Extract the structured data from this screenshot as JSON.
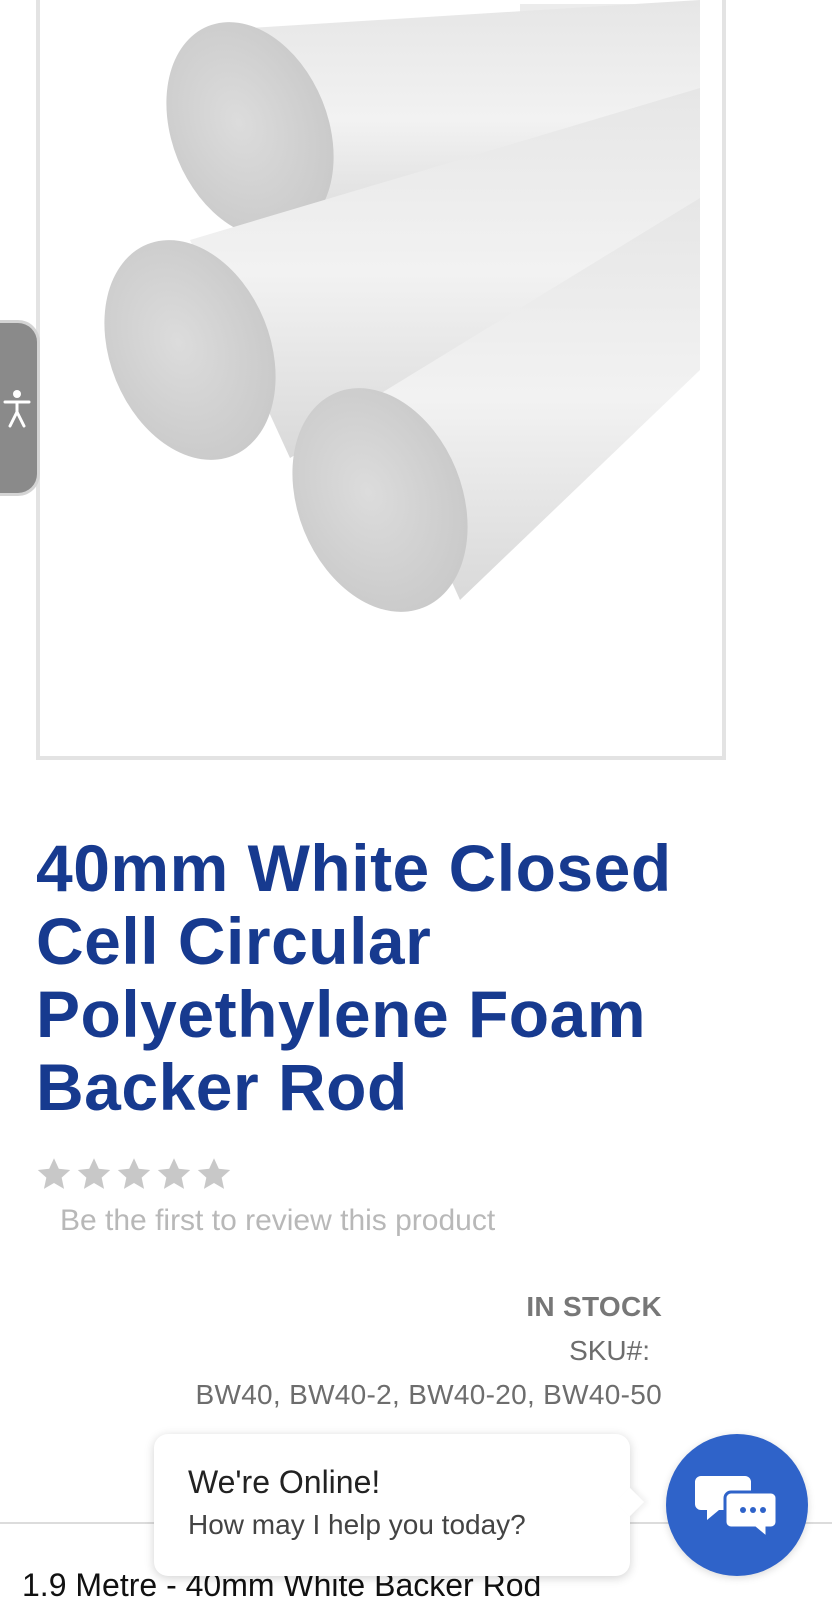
{
  "product": {
    "title": "40mm White Closed Cell Circular Polyethylene Foam Backer Rod",
    "image_alt": "White foam backer rods",
    "rating": {
      "value": 0,
      "max": 5
    },
    "review_prompt": "Be the first to review this product",
    "stock_status": "IN STOCK",
    "sku_label": "SKU#:",
    "sku_values": "BW40, BW40-2, BW40-20, BW40-50",
    "option_label": "1.9 Metre - 40mm White Backer Rod"
  },
  "chat": {
    "title": "We're Online!",
    "subtitle": "How may I help you today?"
  },
  "colors": {
    "title": "#173a8f",
    "chat_button": "#2f63c9",
    "star_empty": "#c8c8c8"
  },
  "icons": {
    "accessibility": "accessibility-icon",
    "chat": "chat-icon",
    "star": "star-icon"
  }
}
